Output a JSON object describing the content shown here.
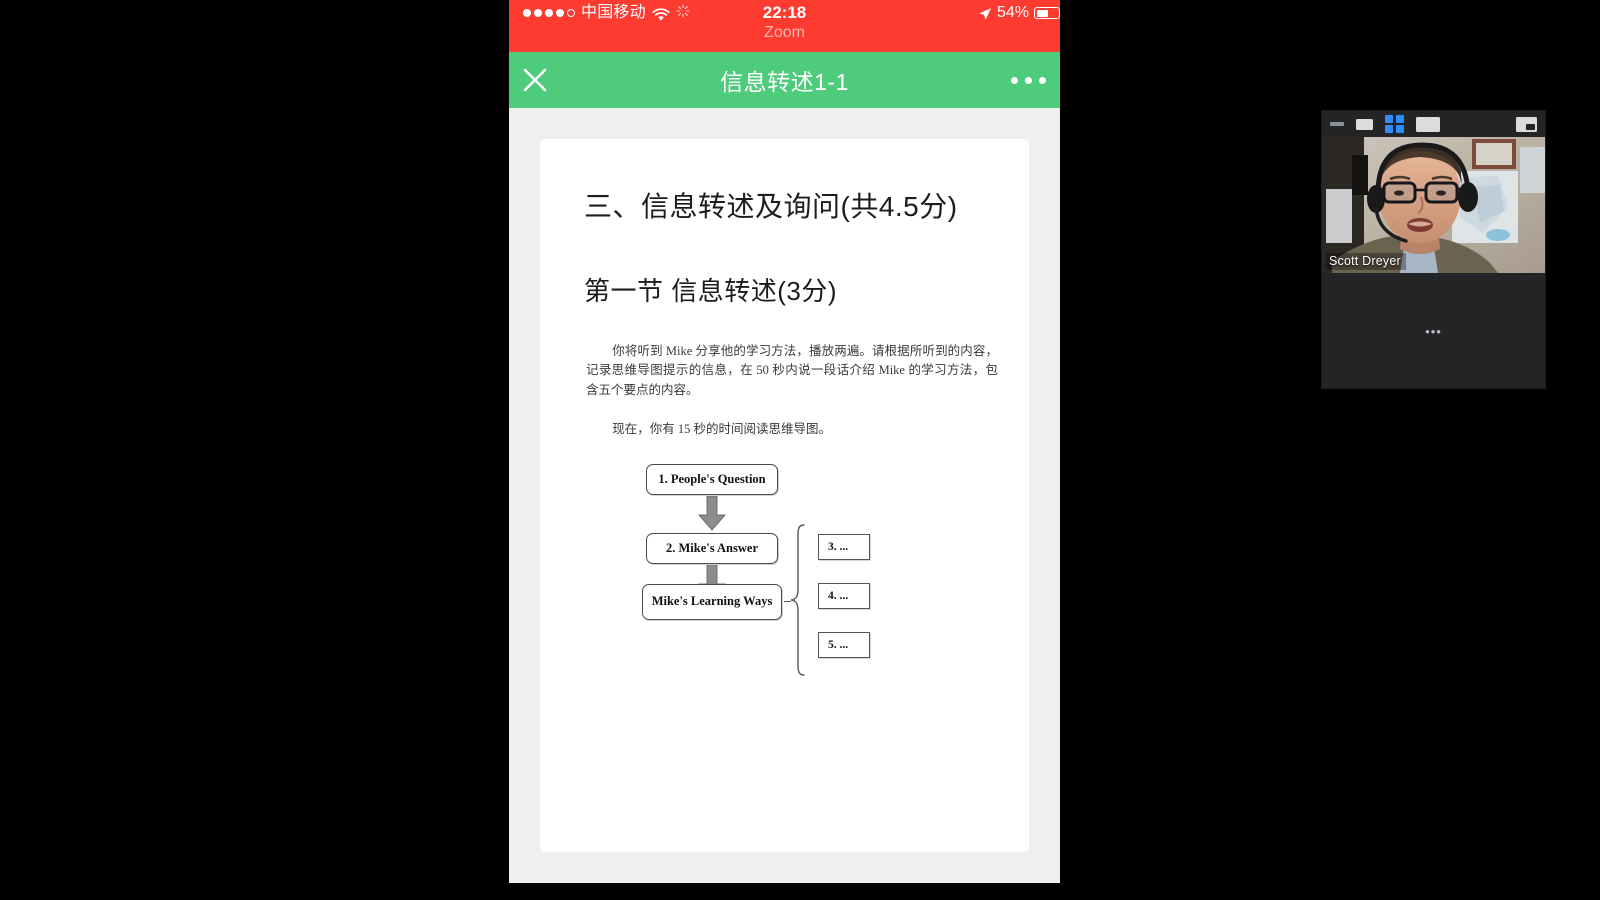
{
  "statusbar": {
    "signal_dots_filled": 4,
    "signal_dots_total": 5,
    "carrier": "中国移动",
    "wifi_icon": "wifi-icon",
    "sync_icon": "sync-spinner-icon",
    "time": "22:18",
    "location_icon": "location-arrow-icon",
    "battery_percent": "54%",
    "battery_level": 54,
    "app_label": "Zoom",
    "bg_color": "#fd3b30"
  },
  "navbar": {
    "close_icon": "close-x-icon",
    "title": "信息转述1-1",
    "more_icon": "more-horizontal-icon",
    "bg_color": "#4ecb7b"
  },
  "document": {
    "heading1": "三、信息转述及询问(共4.5分)",
    "heading2": "第一节 信息转述(3分)",
    "paragraph1": "你将听到 Mike 分享他的学习方法，播放两遍。请根据所听到的内容，记录思维导图提示的信息，在 50 秒内说一段话介绍 Mike 的学习方法，包含五个要点的内容。",
    "paragraph2": "现在，你有 15 秒的时间阅读思维导图。"
  },
  "flowchart": {
    "node1": "1. People's Question",
    "node2": "2. Mike's Answer",
    "node3": "Mike's Learning Ways",
    "sub3": "3. ...",
    "sub4": "4. ...",
    "sub5": "5. ...",
    "arrow1_icon": "down-arrow-icon",
    "arrow2_icon": "down-arrow-icon",
    "brace_icon": "curly-brace-icon"
  },
  "zoom_panel": {
    "minimize_icon": "minimize-icon",
    "small_view_icon": "small-view-icon",
    "gallery_view_icon": "gallery-view-icon",
    "speaker_view_icon": "speaker-view-icon",
    "pip_icon": "picture-in-picture-icon",
    "participant_name": "Scott Dreyer",
    "placeholder_ellipsis": "•••",
    "accent_color": "#2d8cff",
    "bg_color": "#222426"
  }
}
